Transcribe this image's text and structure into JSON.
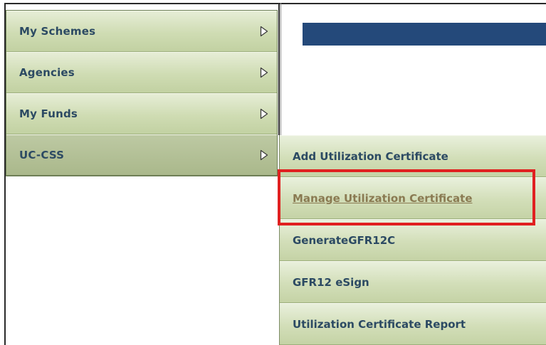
{
  "sidebar": {
    "items": [
      {
        "label": "My Schemes"
      },
      {
        "label": "Agencies"
      },
      {
        "label": "My Funds"
      },
      {
        "label": "UC-CSS"
      }
    ]
  },
  "submenu": {
    "items": [
      {
        "label": "Add Utilization Certificate"
      },
      {
        "label": "Manage Utilization Certificate"
      },
      {
        "label": "GenerateGFR12C"
      },
      {
        "label": "GFR12 eSign"
      },
      {
        "label": "Utilization Certificate Report"
      }
    ]
  },
  "colors": {
    "menu_text": "#2c4a63",
    "hover_text": "#8a7a52",
    "highlight_border": "#e02020",
    "top_bar": "#24497a"
  },
  "icons": {
    "menu_arrow": "chevron-right-outline-icon"
  }
}
